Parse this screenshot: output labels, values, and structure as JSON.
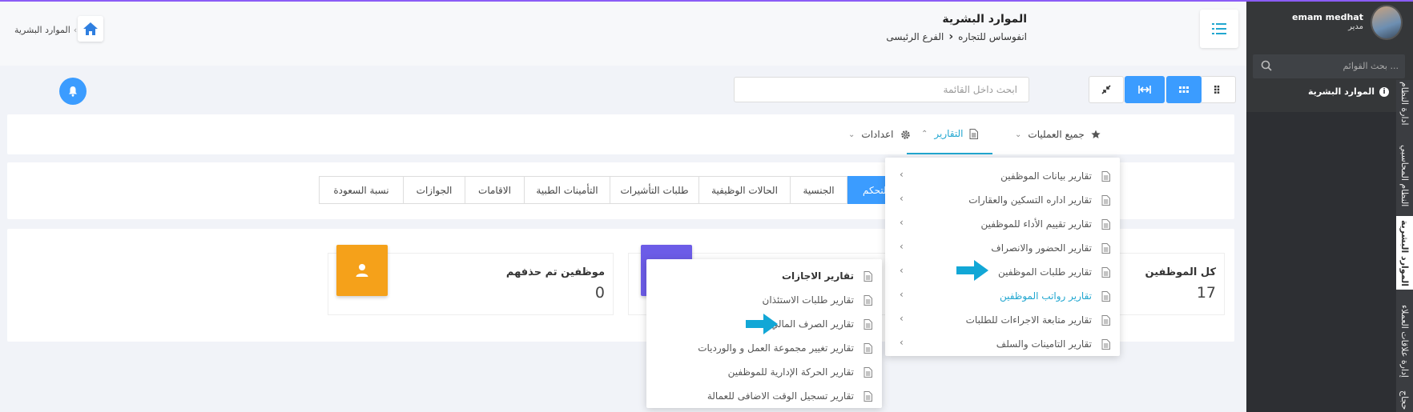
{
  "header": {
    "title": "الموارد البشرية",
    "company": "انفوساس للتجاره",
    "branch": "الفرع الرئيسى",
    "home_breadcrumb": "الموارد البشرية"
  },
  "sidebar": {
    "user_name": "emam medhat",
    "user_role": "مدير",
    "search_placeholder": "بحث القوائم ...",
    "active_module": "الموارد البشرية",
    "vertical_tabs": [
      "ادارة النظام",
      "النظام المحاسبي",
      "الموارد البشرية",
      "إدارة علاقات العملاء",
      "حجاج"
    ]
  },
  "toolbar": {
    "search_placeholder": "ابحث داخل القائمة"
  },
  "nav": {
    "all_operations": "جميع العمليات",
    "reports": "التقارير",
    "settings": "اعدادات"
  },
  "tabs": [
    "التحكم",
    "الجنسية",
    "الحالات الوظيفية",
    "طلبات التأشيرات",
    "التأمينات الطبية",
    "الاقامات",
    "الجوازات",
    "نسبة السعودة"
  ],
  "stats": [
    {
      "label": "كل الموظفين",
      "value": "17"
    },
    {
      "label": "موظفين تم حذفهم",
      "value": "0"
    }
  ],
  "reports_menu": [
    "تقارير بيانات الموظفين",
    "تقارير اداره التسكين والعقارات",
    "تقارير تقييم الأداء للموظفين",
    "تقارير الحضور والانصراف",
    "تقارير طلبات الموظفين",
    "تقارير رواتب الموظفين",
    "تقارير متابعة الاجراءات للطلبات",
    "تقارير التامينات والسلف"
  ],
  "requests_submenu": [
    "تقارير الاجازات",
    "تقارير طلبات الاستئذان",
    "تقارير الصرف المالي",
    "تقارير تغيير مجموعة العمل و والورديات",
    "تقارير الحركة الإدارية للموظفين",
    "تقارير تسجيل الوقت الاضافى للعمالة"
  ],
  "colors": {
    "accent": "#3b9cff",
    "teal": "#22a7d0",
    "orange": "#f5a11a",
    "purple": "#6c5ce7",
    "sidebar": "#2d2f33"
  }
}
